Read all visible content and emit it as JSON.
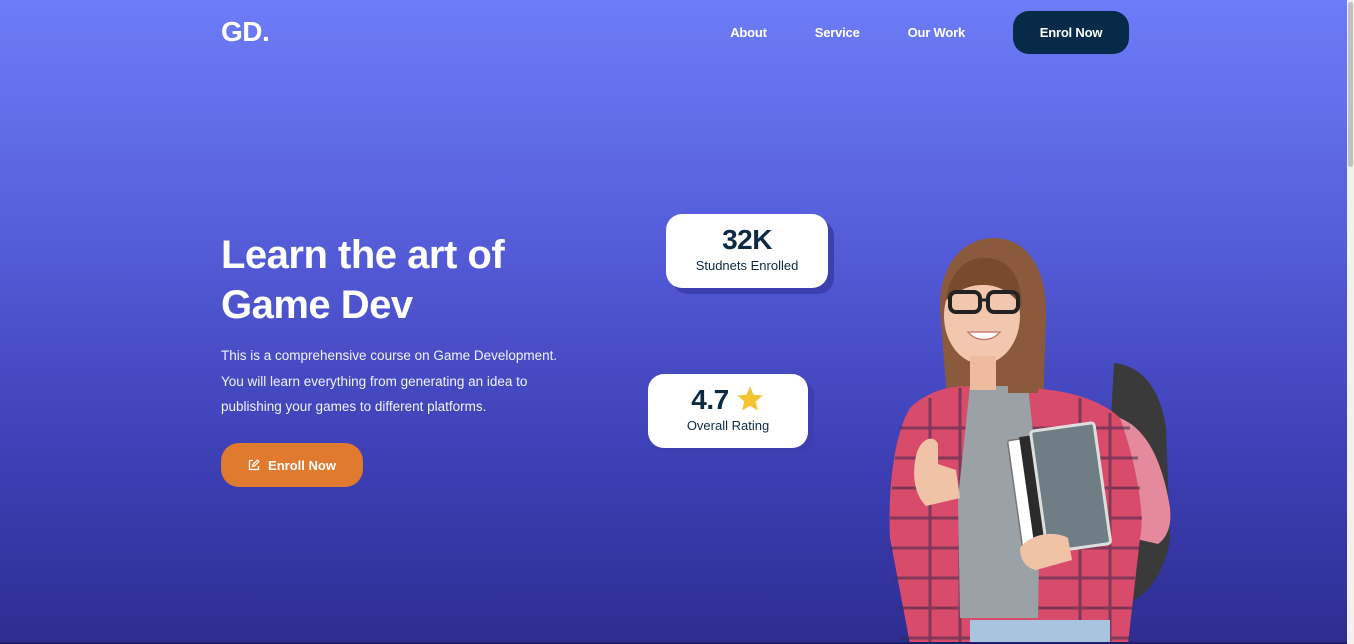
{
  "brand": {
    "logo": "GD."
  },
  "nav": {
    "links": [
      "About",
      "Service",
      "Our Work"
    ],
    "cta": "Enrol Now"
  },
  "hero": {
    "title_line1": "Learn the art of",
    "title_line2": "Game Dev",
    "desc_line1": "This is a comprehensive course on Game Development.",
    "desc_line2": "You will learn everything from generating an idea to",
    "desc_line3": "publishing your games to different platforms.",
    "cta_label": "Enroll Now",
    "cta_icon": "edit-icon"
  },
  "stats": {
    "students_value": "32K",
    "students_label": "Studnets Enrolled",
    "rating_value": "4.7",
    "rating_label": "Overall Rating",
    "rating_icon": "star-icon"
  },
  "colors": {
    "bg_top": "#6d7cf8",
    "bg_bottom": "#2d2d91",
    "nav_button": "#062a47",
    "cta_button": "#e07a2e",
    "star": "#f5c431",
    "card_text": "#0d2a45"
  }
}
